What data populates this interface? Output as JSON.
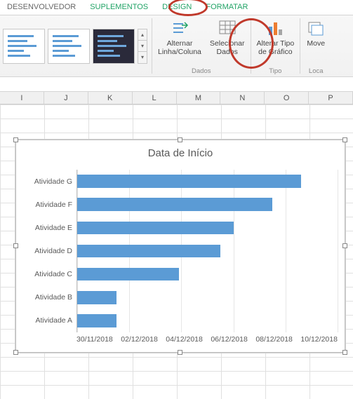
{
  "ribbon": {
    "tabs": {
      "dev": "DESENVOLVEDOR",
      "addins": "SUPLEMENTOS",
      "design": "DESIGN",
      "format": "FORMATAR"
    },
    "buttons": {
      "switch_row_col": {
        "line1": "Alternar",
        "line2": "Linha/Coluna"
      },
      "select_data": {
        "line1": "Selecionar",
        "line2": "Dados"
      },
      "change_type": {
        "line1": "Alterar Tipo",
        "line2": "de Gráfico"
      },
      "move": {
        "line1": "Move"
      }
    },
    "groups": {
      "data": "Dados",
      "type": "Tipo",
      "location": "Loca"
    }
  },
  "columns": [
    "I",
    "J",
    "K",
    "L",
    "M",
    "N",
    "O",
    "P"
  ],
  "chart_data": {
    "type": "bar",
    "title": "Data de Início",
    "categories": [
      "Atividade G",
      "Atividade F",
      "Atividade E",
      "Atividade D",
      "Atividade C",
      "Atividade B",
      "Atividade A"
    ],
    "x_ticks": [
      "30/11/2018",
      "02/12/2018",
      "04/12/2018",
      "06/12/2018",
      "08/12/2018",
      "10/12/2018"
    ],
    "x_numeric": [
      43434,
      43436,
      43438,
      43440,
      43442,
      43444
    ],
    "series": [
      {
        "name": "Data de Início",
        "values_numeric": [
          43442.6,
          43441.5,
          43440.0,
          43439.5,
          43437.9,
          43435.5,
          43435.5
        ],
        "color": "#5b9bd5"
      }
    ],
    "xlabel": "",
    "ylabel": "",
    "xlim": [
      43434,
      43444
    ]
  }
}
